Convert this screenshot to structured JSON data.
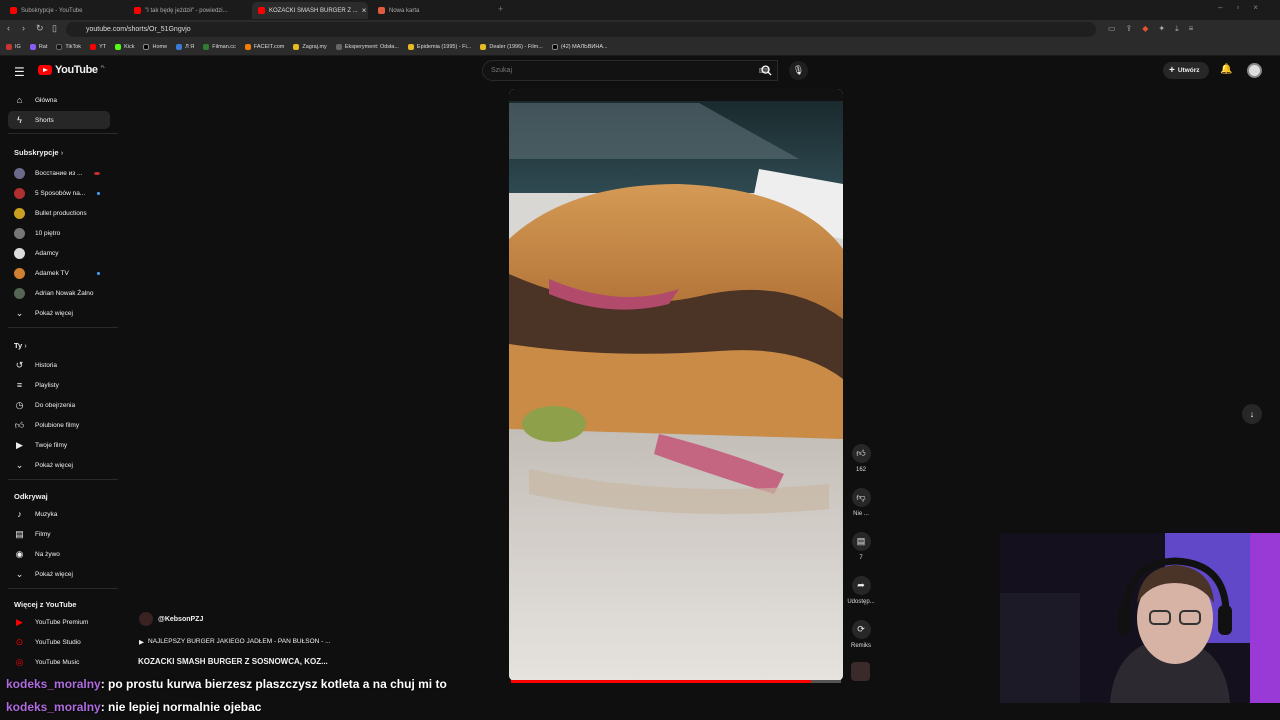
{
  "browser": {
    "tabs": [
      {
        "label": "Subskrypcje - YouTube",
        "color": "#ff0000",
        "active": false
      },
      {
        "label": "\"I tak będę jeździł\" - powiedzi...",
        "color": "#ff0000",
        "active": false
      },
      {
        "label": "KOZACKI SMASH BURGER Z ...",
        "color": "#ff0000",
        "active": true
      },
      {
        "label": "Nowa karta",
        "color": "#e05b3b",
        "active": false
      }
    ],
    "url": "youtube.com/shorts/Or_51Gngvjo",
    "bookmarks": [
      "IG",
      "Rat",
      "TikTok",
      "YT",
      "Kick",
      "Home",
      "Л Я",
      "Filman.cc",
      "FACEIT.com",
      "Zagraj.my",
      "Eksperyment: Odsła...",
      "Epidemia (1995) - Fi...",
      "Dealer (1996) - Film...",
      "(42) МАЛЬВИНА..."
    ]
  },
  "youtube": {
    "logo": "YouTube",
    "country": "PL",
    "search_placeholder": "Szukaj",
    "create_label": "Utwórz",
    "nav": [
      {
        "label": "Główna",
        "icon": "home-icon"
      },
      {
        "label": "Shorts",
        "icon": "shorts-icon"
      }
    ],
    "subs_title": "Subskrypcje",
    "subscriptions": [
      {
        "label": "Восстание из ...",
        "color": "#6a6a8a"
      },
      {
        "label": "5 Sposobów na...",
        "color": "#b03030"
      },
      {
        "label": "Bullet productions",
        "color": "#c9a020"
      },
      {
        "label": "10 piętro",
        "color": "#777"
      },
      {
        "label": "Adamcy",
        "color": "#ddd"
      },
      {
        "label": "Adamek TV",
        "color": "#d08030"
      },
      {
        "label": "Adrian Nowak Żalno",
        "color": "#556655"
      }
    ],
    "show_more": "Pokaż więcej",
    "you_title": "Ty",
    "you_items": [
      {
        "label": "Historia",
        "icon": "history-icon"
      },
      {
        "label": "Playlisty",
        "icon": "playlist-icon"
      },
      {
        "label": "Do obejrzenia",
        "icon": "clock-icon"
      },
      {
        "label": "Polubione filmy",
        "icon": "thumb-up-icon"
      },
      {
        "label": "Twoje filmy",
        "icon": "video-icon"
      },
      {
        "label": "Pokaż więcej",
        "icon": "chevron-down-icon"
      }
    ],
    "explore_title": "Odkrywaj",
    "explore_items": [
      {
        "label": "Muzyka",
        "icon": "music-icon"
      },
      {
        "label": "Filmy",
        "icon": "film-icon"
      },
      {
        "label": "Na żywo",
        "icon": "live-icon"
      },
      {
        "label": "Pokaż więcej",
        "icon": "chevron-down-icon"
      }
    ],
    "more_title": "Więcej z YouTube",
    "more_items": [
      "YouTube Premium",
      "YouTube Studio",
      "YouTube Music"
    ],
    "short": {
      "channel": "@KebsonPZJ",
      "playlist": "NAJLEPSZY BURGER JAKIEGO JADŁEM - PAN BUŁSON - ...",
      "title": "KOZACKI SMASH BURGER Z SOSNOWCA, KOZ...",
      "likes": "162",
      "dislike_label": "Nie ...",
      "comments": "7",
      "share_label": "Udostęp...",
      "remix_label": "Remiks",
      "progress": 0.91
    }
  },
  "chat": [
    {
      "user": "kodeks_moralny",
      "message": ": po prostu kurwa bierzesz plaszczysz kotleta a na chuj mi to"
    },
    {
      "user": "kodeks_moralny",
      "message": ": nie lepiej normalnie ojebac"
    }
  ]
}
